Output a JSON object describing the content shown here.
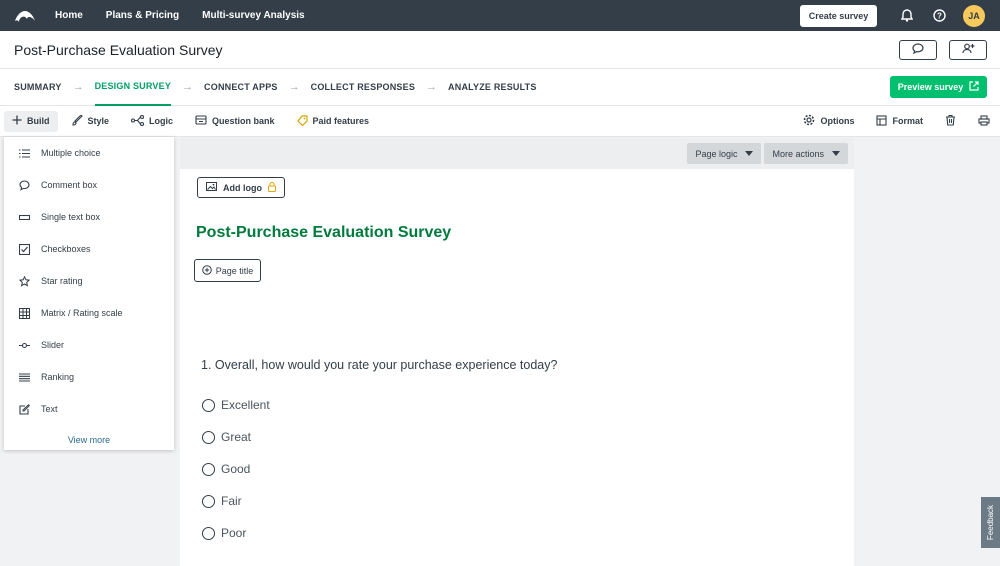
{
  "topnav": {
    "links": [
      "Home",
      "Plans & Pricing",
      "Multi-survey Analysis"
    ],
    "create_label": "Create survey",
    "avatar_initials": "JA"
  },
  "titlebar": {
    "title": "Post-Purchase Evaluation Survey"
  },
  "steps": {
    "items": [
      "SUMMARY",
      "DESIGN SURVEY",
      "CONNECT APPS",
      "COLLECT RESPONSES",
      "ANALYZE RESULTS"
    ],
    "active_index": 1,
    "preview_label": "Preview survey"
  },
  "toolbar": {
    "build": "Build",
    "style": "Style",
    "logic": "Logic",
    "question_bank": "Question bank",
    "paid_features": "Paid features",
    "options": "Options",
    "format": "Format"
  },
  "build_panel": {
    "items": [
      {
        "label": "Multiple choice",
        "icon": "list-icon"
      },
      {
        "label": "Comment box",
        "icon": "speech-bubble-icon"
      },
      {
        "label": "Single text box",
        "icon": "textbox-icon"
      },
      {
        "label": "Checkboxes",
        "icon": "checkbox-icon"
      },
      {
        "label": "Star rating",
        "icon": "star-icon"
      },
      {
        "label": "Matrix / Rating scale",
        "icon": "grid-icon"
      },
      {
        "label": "Slider",
        "icon": "slider-icon"
      },
      {
        "label": "Ranking",
        "icon": "ranking-icon"
      },
      {
        "label": "Text",
        "icon": "edit-icon"
      }
    ],
    "view_more": "View more"
  },
  "canvas": {
    "page_logic": "Page logic",
    "more_actions": "More actions",
    "add_logo": "Add logo",
    "heading": "Post-Purchase Evaluation Survey",
    "page_title_btn": "Page title",
    "question": "1. Overall, how would you rate your purchase experience today?",
    "options": [
      "Excellent",
      "Great",
      "Good",
      "Fair",
      "Poor"
    ]
  },
  "feedback_label": "Feedback",
  "colors": {
    "nav_bg": "#333e48",
    "accent_green": "#00bf6f",
    "heading_green": "#007a3d",
    "avatar": "#f5c95c"
  }
}
